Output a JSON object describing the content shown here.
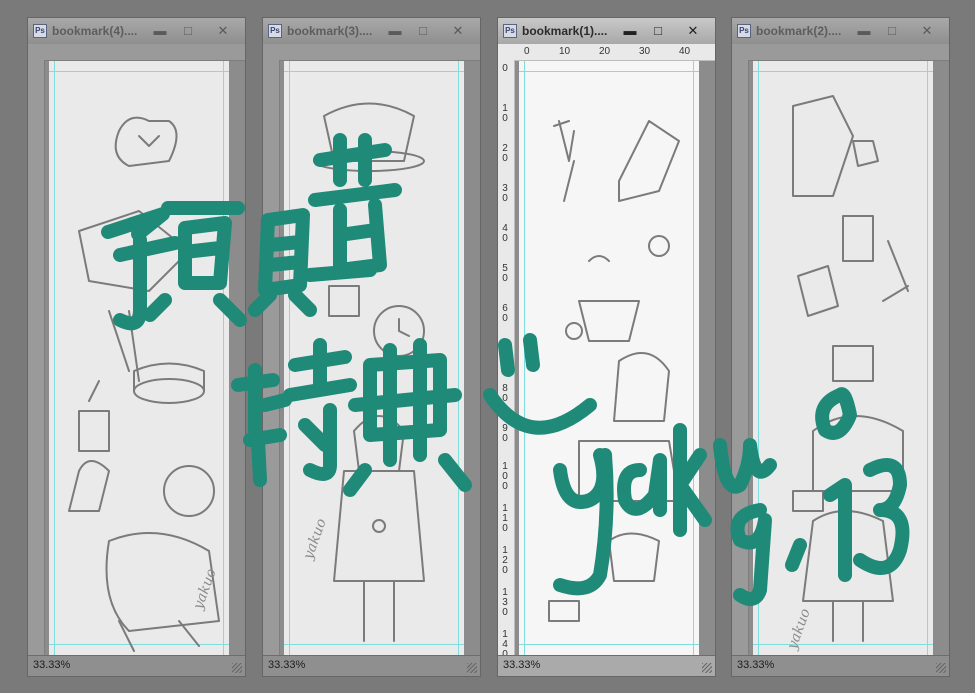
{
  "windows": [
    {
      "title": "bookmark(4)....",
      "zoom": "33.33%",
      "active": false
    },
    {
      "title": "bookmark(3)....",
      "zoom": "33.33%",
      "active": false
    },
    {
      "title": "bookmark(1)....",
      "zoom": "33.33%",
      "active": true
    },
    {
      "title": "bookmark(2)....",
      "zoom": "33.33%",
      "active": false
    }
  ],
  "window_controls": {
    "minimize": "▬",
    "maximize": "□",
    "close": "✕"
  },
  "app_icon_label": "Ps",
  "ruler": {
    "horizontal": [
      "0",
      "10",
      "20",
      "30",
      "40"
    ],
    "vertical": [
      [
        "0"
      ],
      [
        "1",
        "0"
      ],
      [
        "2",
        "0"
      ],
      [
        "3",
        "0"
      ],
      [
        "4",
        "0"
      ],
      [
        "5",
        "0"
      ],
      [
        "6",
        "0"
      ],
      [
        "7",
        "0"
      ],
      [
        "8",
        "0"
      ],
      [
        "9",
        "0"
      ],
      [
        "1",
        "0",
        "0"
      ],
      [
        "1",
        "1",
        "0"
      ],
      [
        "1",
        "2",
        "0"
      ],
      [
        "1",
        "3",
        "0"
      ],
      [
        "1",
        "4",
        "0"
      ]
    ]
  },
  "artwork": {
    "signature": "yakuo",
    "overlay_text": {
      "line1": "預購",
      "line2": "特典",
      "smile": "ツ",
      "signature": "yakuo",
      "date": "9.13"
    }
  },
  "colors": {
    "overlay_teal": "#1f8a78",
    "guide": "#7fdedd"
  }
}
